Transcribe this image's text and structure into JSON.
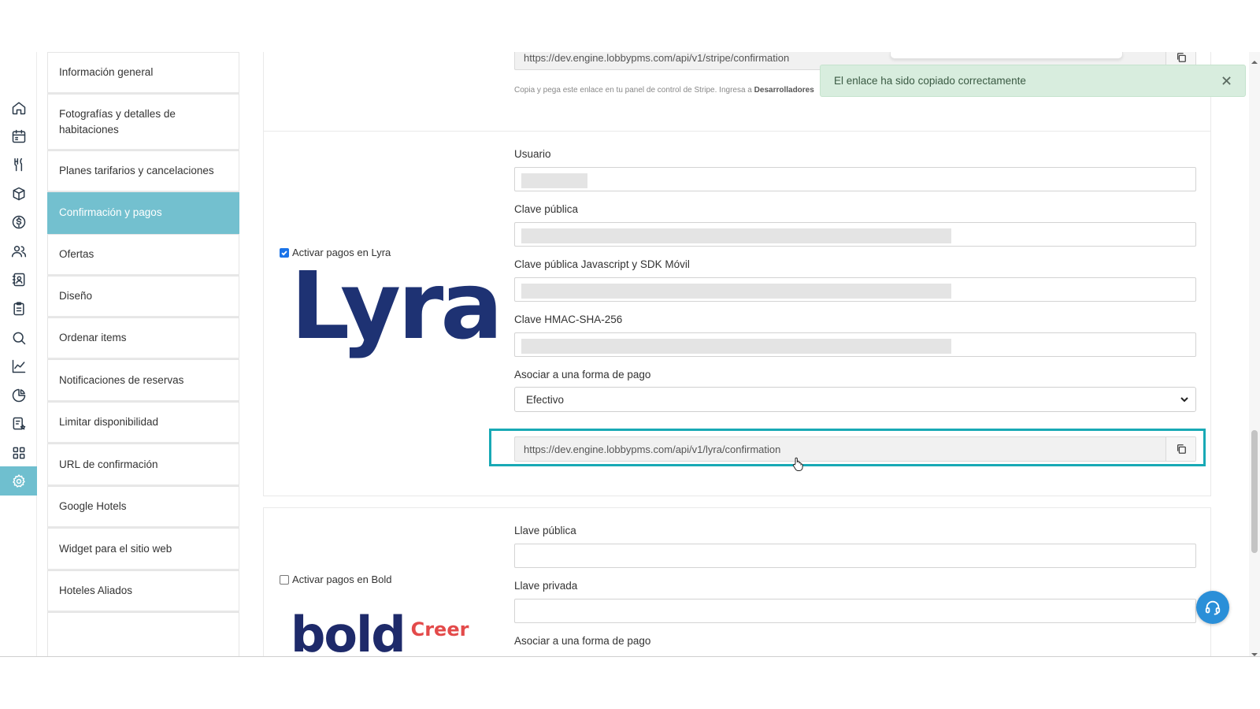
{
  "rail": {
    "icons": [
      "home-icon",
      "calendar-icon",
      "restaurant-icon",
      "box-icon",
      "dollar-icon",
      "users-icon",
      "contacts-icon",
      "clipboard-icon",
      "search-icon",
      "chart-icon",
      "pie-chart-icon",
      "badge-list-icon",
      "grid-icon",
      "gear-icon"
    ],
    "active": "gear-icon"
  },
  "nav": {
    "items": [
      {
        "label": "Información general"
      },
      {
        "label": "Fotografías y detalles de habitaciones"
      },
      {
        "label": "Planes tarifarios y cancelaciones"
      },
      {
        "label": "Confirmación y pagos"
      },
      {
        "label": "Ofertas"
      },
      {
        "label": "Diseño"
      },
      {
        "label": "Ordenar items"
      },
      {
        "label": "Notificaciones de reservas"
      },
      {
        "label": "Limitar disponibilidad"
      },
      {
        "label": "URL de confirmación"
      },
      {
        "label": "Google Hotels"
      },
      {
        "label": "Widget para el sitio web"
      },
      {
        "label": "Hoteles Aliados"
      }
    ],
    "active_index": 3
  },
  "stripe": {
    "url": "https://dev.engine.lobbypms.com/api/v1/stripe/confirmation",
    "hint_prefix": "Copia y pega este enlace en tu panel de control de Stripe. Ingresa a",
    "hint_bold": "Desarrolladores"
  },
  "toast": {
    "message": "El enlace ha sido copiado correctamente"
  },
  "lyra": {
    "checkbox_label": "Activar pagos en Lyra",
    "checked": true,
    "logo_text": "Lyra",
    "fields": {
      "usuario": "Usuario",
      "clave_publica": "Clave pública",
      "clave_js": "Clave pública Javascript y SDK Móvil",
      "clave_hmac": "Clave HMAC-SHA-256",
      "asociar": "Asociar a una forma de pago"
    },
    "payment_method": "Efectivo",
    "url": "https://dev.engine.lobbypms.com/api/v1/lyra/confirmation"
  },
  "bold": {
    "checkbox_label": "Activar pagos en Bold",
    "checked": false,
    "logo_word": "bold",
    "logo_tag": "Creer",
    "fields": {
      "llave_publica": "Llave pública",
      "llave_privada": "Llave privada",
      "asociar": "Asociar a una forma de pago"
    }
  }
}
